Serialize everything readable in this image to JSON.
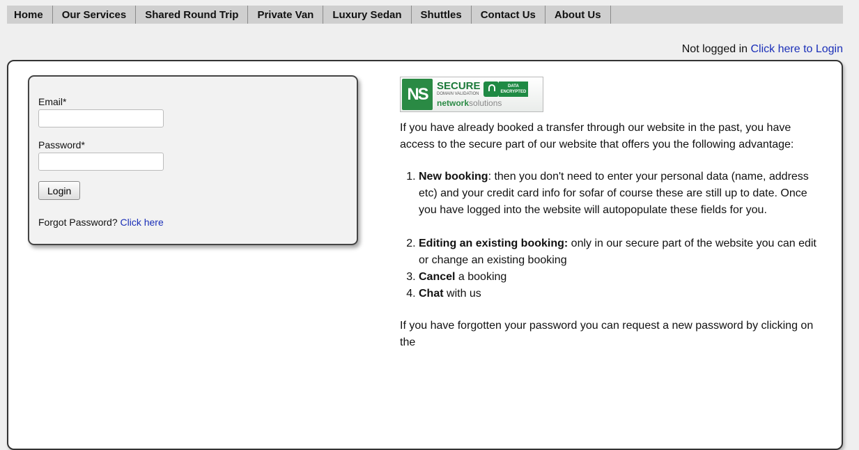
{
  "nav": {
    "items": [
      "Home",
      "Our Services",
      "Shared Round Trip",
      "Private Van",
      "Luxury Sedan",
      "Shuttles",
      "Contact Us",
      "About Us"
    ]
  },
  "status": {
    "text": "Not logged in",
    "login_link": "Click here to Login"
  },
  "login_form": {
    "email_label": "Email*",
    "email_value": "",
    "password_label": "Password*",
    "password_value": "",
    "login_button": "Login",
    "forgot_text": "Forgot Password?",
    "forgot_link": "Click here"
  },
  "badge": {
    "logo": "NS",
    "secure": "SECURE",
    "sub": "DOMAIN VALIDATION",
    "enc_line1": "DATA",
    "enc_line2": "ENCRYPTED",
    "brand_a": "network",
    "brand_b": "solutions",
    "lock_icon": "lock-icon"
  },
  "info": {
    "intro": "If you have already booked a transfer through our website in the past, you have access to the secure part of our website that offers you the following advantage:",
    "items": [
      {
        "bold": "New booking",
        "text": ": then you don't need to enter your personal data (name, address etc) and your credit card info for sofar of course these are still up to date. Once you have logged into the website will autopopulate these fields for you."
      },
      {
        "bold": "Editing an existing booking:",
        "text": " only in our secure part of the website you can edit or change an existing booking"
      },
      {
        "bold": "Cancel",
        "text": " a booking"
      },
      {
        "bold": "Chat",
        "text": " with us"
      }
    ],
    "outro": "If you have forgotten your password you can request a new password by clicking on the"
  }
}
